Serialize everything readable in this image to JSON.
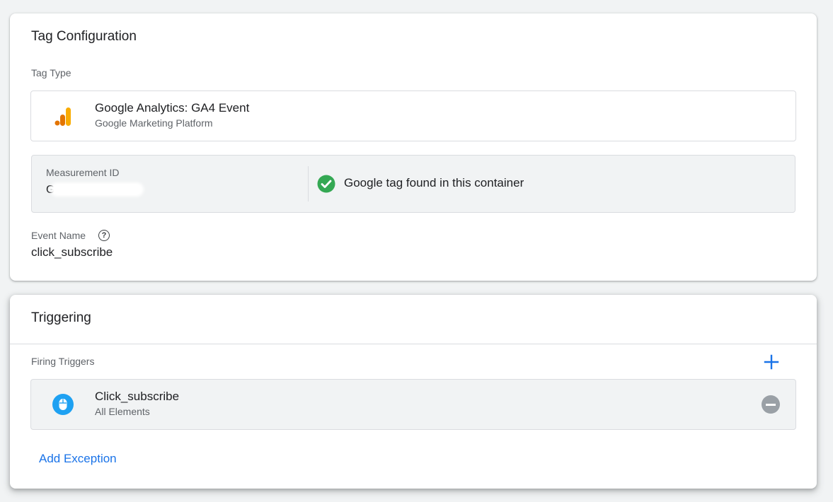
{
  "tag_configuration": {
    "title": "Tag Configuration",
    "tag_type_label": "Tag Type",
    "tag_type": {
      "name": "Google Analytics: GA4 Event",
      "provider": "Google Marketing Platform",
      "icon": "analytics-bars-icon"
    },
    "measurement": {
      "label": "Measurement ID",
      "value": "G",
      "status_text": "Google tag found in this container",
      "status_icon": "check-circle-icon"
    },
    "event_name": {
      "label": "Event Name",
      "value": "click_subscribe",
      "help_glyph": "?"
    }
  },
  "triggering": {
    "title": "Triggering",
    "firing_label": "Firing Triggers",
    "add_glyph": "+",
    "triggers": [
      {
        "name": "Click_subscribe",
        "type": "All Elements",
        "icon": "mouse-icon"
      }
    ],
    "add_exception": "Add Exception"
  },
  "colors": {
    "accent": "#1a73e8",
    "success": "#34a853",
    "trigger_icon": "#1ea1f2",
    "analytics_orange": "#f9ab00",
    "analytics_dark_orange": "#e37400"
  }
}
